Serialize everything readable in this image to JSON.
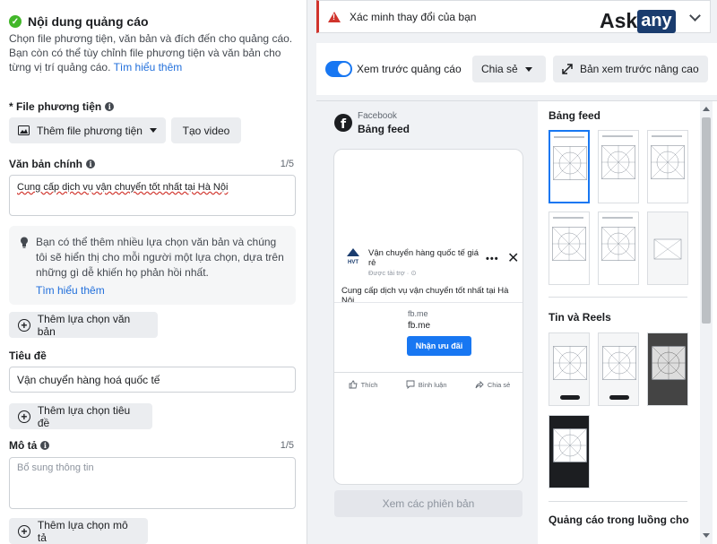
{
  "left": {
    "section_title": "Nội dung quảng cáo",
    "section_desc": "Chọn file phương tiện, văn bản và đích đến cho quảng cáo. Bạn còn có thể tùy chỉnh file phương tiện và văn bản cho từng vị trí quảng cáo.",
    "learn_more": "Tìm hiểu thêm",
    "media_label": "* File phương tiện",
    "add_media": "Thêm file phương tiện",
    "create_video": "Tạo video",
    "primary_text_label": "Văn bản chính",
    "primary_text_count": "1/5",
    "primary_text_value": "Cung cấp dịch vụ vận chuyển tốt nhất tại Hà Nội",
    "tip_text": "Bạn có thể thêm nhiều lựa chọn văn bản và chúng tôi sẽ hiển thị cho mỗi người một lựa chọn, dựa trên những gì dễ khiến họ phản hồi nhất.",
    "tip_link": "Tìm hiểu thêm",
    "add_text_option": "Thêm lựa chọn văn bản",
    "headline_label": "Tiêu đề",
    "headline_value": "Vận chuyển hàng hoá quốc tế",
    "add_headline_option": "Thêm lựa chọn tiêu đề",
    "desc_label": "Mô tả",
    "desc_count": "1/5",
    "desc_placeholder": "Bổ sung thông tin",
    "add_desc_option": "Thêm lựa chọn mô tả"
  },
  "alert": {
    "text": "Xác minh thay đổi của bạn",
    "logo_ask": "Ask",
    "logo_any": "any"
  },
  "preview_bar": {
    "toggle_label": "Xem trước quảng cáo",
    "share": "Chia sẻ",
    "advanced": "Bản xem trước nâng cao"
  },
  "preview": {
    "source": "Facebook",
    "placement": "Bảng feed",
    "page_name": "Vận chuyển hàng quốc tế giá rẻ",
    "sponsored": "Được tài trợ · ⊙",
    "post_text": "Cung cấp dịch vụ vận chuyển tốt nhất tại Hà Nội",
    "domain_small": "fb.me",
    "domain": "fb.me",
    "cta": "Nhận ưu đãi",
    "like": "Thích",
    "comment": "Bình luận",
    "share": "Chia sẻ",
    "versions": "Xem các phiên bản",
    "logo_text": "HVT"
  },
  "placements": {
    "feed_title": "Bảng feed",
    "stories_title": "Tin và Reels",
    "instream_title": "Quảng cáo trong luồng cho"
  }
}
